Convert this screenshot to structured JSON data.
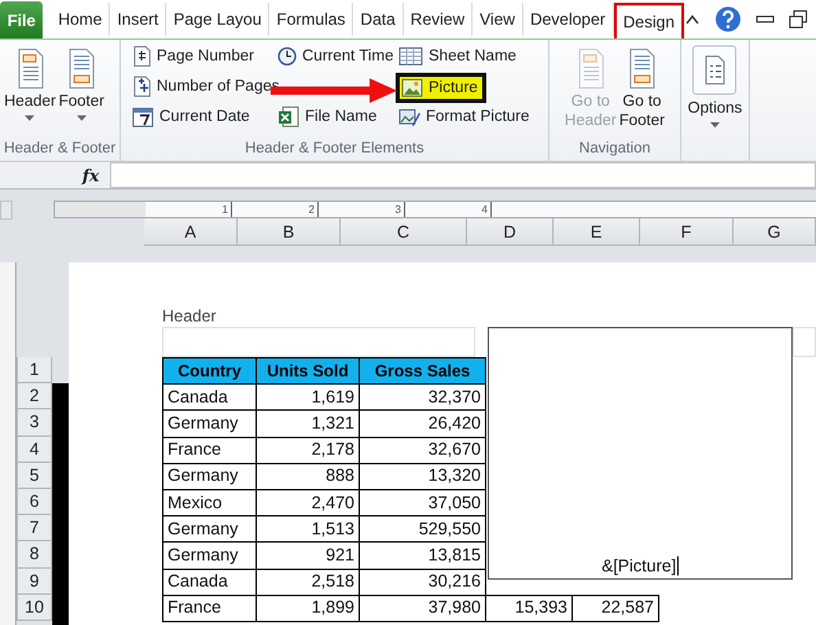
{
  "tabs": [
    {
      "label": "File",
      "kind": "file",
      "selected": false
    },
    {
      "label": "Home",
      "kind": "tab",
      "selected": false
    },
    {
      "label": "Insert",
      "kind": "tab",
      "selected": false
    },
    {
      "label": "Page Layou",
      "kind": "tab",
      "selected": false
    },
    {
      "label": "Formulas",
      "kind": "tab",
      "selected": false
    },
    {
      "label": "Data",
      "kind": "tab",
      "selected": false
    },
    {
      "label": "Review",
      "kind": "tab",
      "selected": false
    },
    {
      "label": "View",
      "kind": "tab",
      "selected": false
    },
    {
      "label": "Developer",
      "kind": "tab",
      "selected": false
    },
    {
      "label": "Design",
      "kind": "tab",
      "selected": true
    }
  ],
  "ribbon": {
    "groups": [
      {
        "title": "Header & Footer",
        "kind": "large",
        "items": [
          {
            "label": "Header",
            "disabled": false,
            "dropdown": true
          },
          {
            "label": "Footer",
            "disabled": false,
            "dropdown": true
          }
        ]
      },
      {
        "title": "Header & Footer Elements",
        "kind": "small",
        "items": [
          {
            "label": "Page Number",
            "highlighted": false
          },
          {
            "label": "Number of Pages",
            "highlighted": false
          },
          {
            "label": "Current Date",
            "highlighted": false
          },
          {
            "label": "Current Time",
            "highlighted": false
          },
          {
            "label": "File Name",
            "highlighted": false
          },
          {
            "label": "Sheet Name",
            "highlighted": false
          },
          {
            "label": "Picture",
            "highlighted": true
          },
          {
            "label": "Format Picture",
            "highlighted": false
          }
        ]
      },
      {
        "title": "Navigation",
        "kind": "large",
        "items": [
          {
            "label": "Go to Header",
            "disabled": true
          },
          {
            "label": "Go to Footer",
            "disabled": false
          }
        ]
      },
      {
        "kind": "large",
        "items": [
          {
            "label": "Options",
            "disabled": false,
            "dropdown": true
          }
        ]
      }
    ]
  },
  "formula_bar": {
    "function_label": "fx"
  },
  "columns": [
    "A",
    "B",
    "C",
    "D",
    "E",
    "F",
    "G"
  ],
  "ruler_marks": [
    "1",
    "2",
    "3",
    "4"
  ],
  "page": {
    "header_label": "Header",
    "header_field_value": "&[Picture]",
    "table": {
      "header": [
        "Country",
        "Units Sold",
        "Gross Sales"
      ],
      "rows": [
        [
          "Canada",
          "1,619",
          "32,370"
        ],
        [
          "Germany",
          "1,321",
          "26,420"
        ],
        [
          "France",
          "2,178",
          "32,670"
        ],
        [
          "Germany",
          "888",
          "13,320"
        ],
        [
          "Mexico",
          "2,470",
          "37,050"
        ],
        [
          "Germany",
          "1,513",
          "529,550"
        ],
        [
          "Germany",
          "921",
          "13,815"
        ],
        [
          "Canada",
          "2,518",
          "30,216"
        ],
        [
          "France",
          "1,899",
          "37,980",
          "15,393",
          "22,587"
        ]
      ]
    },
    "row_numbers": [
      "1",
      "2",
      "3",
      "4",
      "5",
      "6",
      "7",
      "8",
      "9",
      "10"
    ]
  }
}
